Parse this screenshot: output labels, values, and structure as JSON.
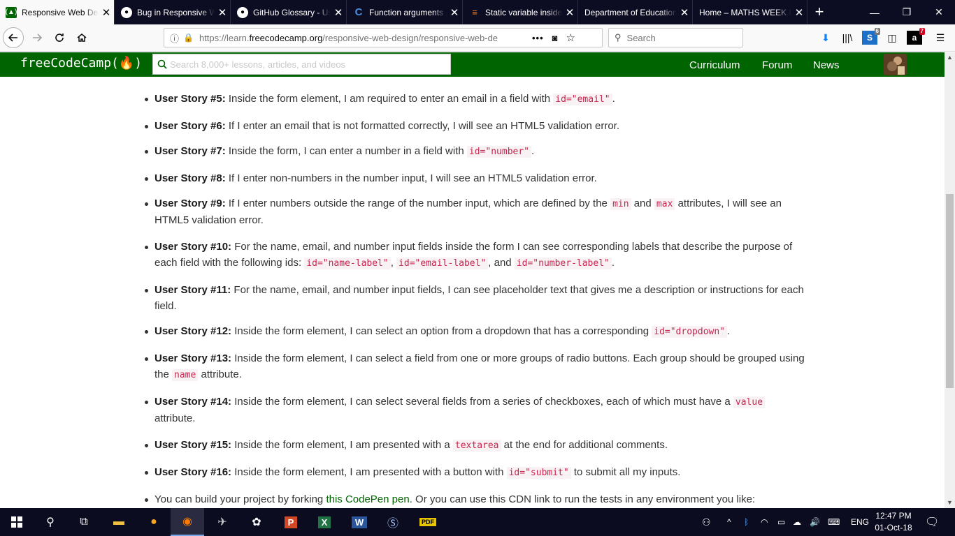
{
  "browser": {
    "tabs": [
      {
        "title": "Responsive Web Design Projects",
        "favicon": "freecodecamp-favicon",
        "active": true
      },
      {
        "title": "Bug in Responsive Web Design",
        "favicon": "github-favicon"
      },
      {
        "title": "GitHub Glossary - User Documentation",
        "favicon": "github-favicon"
      },
      {
        "title": "Function arguments",
        "favicon": "c-favicon"
      },
      {
        "title": "Static variable inside function",
        "favicon": "stackoverflow-favicon"
      },
      {
        "title": "Department of Education",
        "favicon": "none"
      },
      {
        "title": "Home – MATHS WEEK IRELAND",
        "favicon": "none"
      }
    ],
    "url": {
      "scheme": "https://learn.",
      "host": "freecodecamp.org",
      "path": "/responsive-web-design/responsive-web-de"
    },
    "search_placeholder": "Search",
    "badges": {
      "sync": "6",
      "extension": "7"
    }
  },
  "fcc": {
    "logo": "freeCodeCamp(🔥)",
    "search_placeholder": "Search 8,000+ lessons, articles, and videos",
    "nav": [
      "Curriculum",
      "Forum",
      "News"
    ]
  },
  "stories": [
    {
      "label": "User Story #5:",
      "parts": [
        "Inside the form element, I am required to enter an email in a field with ",
        {
          "code": "id=\"email\""
        },
        "."
      ]
    },
    {
      "label": "User Story #6:",
      "parts": [
        "If I enter an email that is not formatted correctly, I will see an HTML5 validation error."
      ]
    },
    {
      "label": "User Story #7:",
      "parts": [
        "Inside the form, I can enter a number in a field with ",
        {
          "code": "id=\"number\""
        },
        "."
      ]
    },
    {
      "label": "User Story #8:",
      "parts": [
        "If I enter non-numbers in the number input, I will see an HTML5 validation error."
      ]
    },
    {
      "label": "User Story #9:",
      "parts": [
        "If I enter numbers outside the range of the number input, which are defined by the ",
        {
          "code": "min"
        },
        " and ",
        {
          "code": "max"
        },
        " attributes, I will see an HTML5 validation error."
      ]
    },
    {
      "label": "User Story #10:",
      "parts": [
        "For the name, email, and number input fields inside the form I can see corresponding labels that describe the purpose of each field with the following ids: ",
        {
          "code": "id=\"name-label\""
        },
        ", ",
        {
          "code": "id=\"email-label\""
        },
        ", and ",
        {
          "code": "id=\"number-label\""
        },
        "."
      ]
    },
    {
      "label": "User Story #11:",
      "parts": [
        "For the name, email, and number input fields, I can see placeholder text that gives me a description or instructions for each field."
      ]
    },
    {
      "label": "User Story #12:",
      "parts": [
        "Inside the form element, I can select an option from a dropdown that has a corresponding ",
        {
          "code": "id=\"dropdown\""
        },
        "."
      ]
    },
    {
      "label": "User Story #13:",
      "parts": [
        "Inside the form element, I can select a field from one or more groups of radio buttons. Each group should be grouped using the ",
        {
          "code": "name"
        },
        " attribute."
      ]
    },
    {
      "label": "User Story #14:",
      "parts": [
        "Inside the form element, I can select several fields from a series of checkboxes, each of which must have a ",
        {
          "code": "value"
        },
        " attribute."
      ]
    },
    {
      "label": "User Story #15:",
      "parts": [
        "Inside the form element, I am presented with a ",
        {
          "code": "textarea"
        },
        " at the end for additional comments."
      ]
    },
    {
      "label": "User Story #16:",
      "parts": [
        "Inside the form element, I am presented with a button with ",
        {
          "code": "id=\"submit\""
        },
        " to submit all my inputs."
      ]
    },
    {
      "label": "",
      "parts": [
        "You can build your project by forking ",
        {
          "link": "this CodePen pen"
        },
        ". Or you can use this CDN link to run the tests in any environment you like:"
      ]
    }
  ],
  "taskbar": {
    "language": "ENG",
    "time": "12:47 PM",
    "date": "01-Oct-18"
  }
}
